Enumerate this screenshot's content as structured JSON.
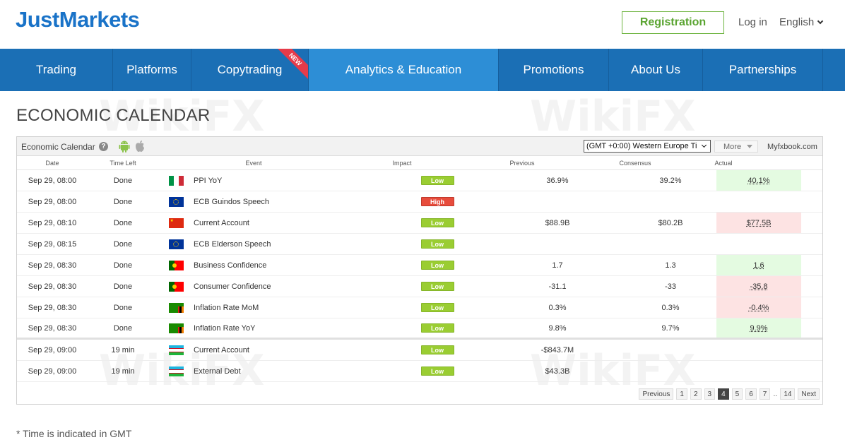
{
  "header": {
    "logo": "JustMarkets",
    "registration_label": "Registration",
    "login_label": "Log in",
    "language_label": "English"
  },
  "nav": {
    "items": [
      {
        "label": "Trading"
      },
      {
        "label": "Platforms"
      },
      {
        "label": "Copytrading",
        "ribbon": "NEW"
      },
      {
        "label": "Analytics & Education",
        "active": true
      },
      {
        "label": "Promotions"
      },
      {
        "label": "About Us"
      },
      {
        "label": "Partnerships"
      }
    ]
  },
  "page_title": "ECONOMIC CALENDAR",
  "calendar": {
    "toolbar_title": "Economic Calendar",
    "help_icon": "?",
    "timezone": "(GMT +0:00) Western Europe Ti",
    "more_label": "More",
    "source_label": "Myfxbook.com",
    "columns": [
      "Date",
      "Time Left",
      "Event",
      "Impact",
      "Previous",
      "Consensus",
      "Actual"
    ],
    "rows": [
      {
        "date": "Sep 29, 08:00",
        "left": "Done",
        "flag": "italy",
        "event": "PPI YoY",
        "impact": "Low",
        "previous": "36.9%",
        "consensus": "39.2%",
        "actual": "40.1%",
        "actual_state": "green"
      },
      {
        "date": "Sep 29, 08:00",
        "left": "Done",
        "flag": "eu",
        "event": "ECB Guindos Speech",
        "impact": "High",
        "previous": "",
        "consensus": "",
        "actual": "",
        "actual_state": ""
      },
      {
        "date": "Sep 29, 08:10",
        "left": "Done",
        "flag": "china",
        "event": "Current Account",
        "impact": "Low",
        "previous": "$88.9B",
        "consensus": "$80.2B",
        "actual": "$77.5B",
        "actual_state": "red"
      },
      {
        "date": "Sep 29, 08:15",
        "left": "Done",
        "flag": "eu",
        "event": "ECB Elderson Speech",
        "impact": "Low",
        "previous": "",
        "consensus": "",
        "actual": "",
        "actual_state": ""
      },
      {
        "date": "Sep 29, 08:30",
        "left": "Done",
        "flag": "portugal",
        "event": "Business Confidence",
        "impact": "Low",
        "previous": "1.7",
        "consensus": "1.3",
        "actual": "1.6",
        "actual_state": "green"
      },
      {
        "date": "Sep 29, 08:30",
        "left": "Done",
        "flag": "portugal",
        "event": "Consumer Confidence",
        "impact": "Low",
        "previous": "-31.1",
        "consensus": "-33",
        "actual": "-35.8",
        "actual_state": "red"
      },
      {
        "date": "Sep 29, 08:30",
        "left": "Done",
        "flag": "zambia",
        "event": "Inflation Rate MoM",
        "impact": "Low",
        "previous": "0.3%",
        "consensus": "0.3%",
        "actual": "-0.4%",
        "actual_state": "red"
      },
      {
        "date": "Sep 29, 08:30",
        "left": "Done",
        "flag": "zambia",
        "event": "Inflation Rate YoY",
        "impact": "Low",
        "previous": "9.8%",
        "consensus": "9.7%",
        "actual": "9.9%",
        "actual_state": "green",
        "separator": true
      },
      {
        "date": "Sep 29, 09:00",
        "left": "19 min",
        "flag": "uzbekistan",
        "event": "Current Account",
        "impact": "Low",
        "previous": "-$843.7M",
        "consensus": "",
        "actual": "",
        "actual_state": ""
      },
      {
        "date": "Sep 29, 09:00",
        "left": "19 min",
        "flag": "uzbekistan",
        "event": "External Debt",
        "impact": "Low",
        "previous": "$43.3B",
        "consensus": "",
        "actual": "",
        "actual_state": ""
      }
    ],
    "pager": {
      "prev_label": "Previous",
      "pages": [
        "1",
        "2",
        "3",
        "4",
        "5",
        "6",
        "7",
        "..",
        "14"
      ],
      "active_page": "4",
      "next_label": "Next"
    }
  },
  "footnote": "* Time is indicated in GMT"
}
